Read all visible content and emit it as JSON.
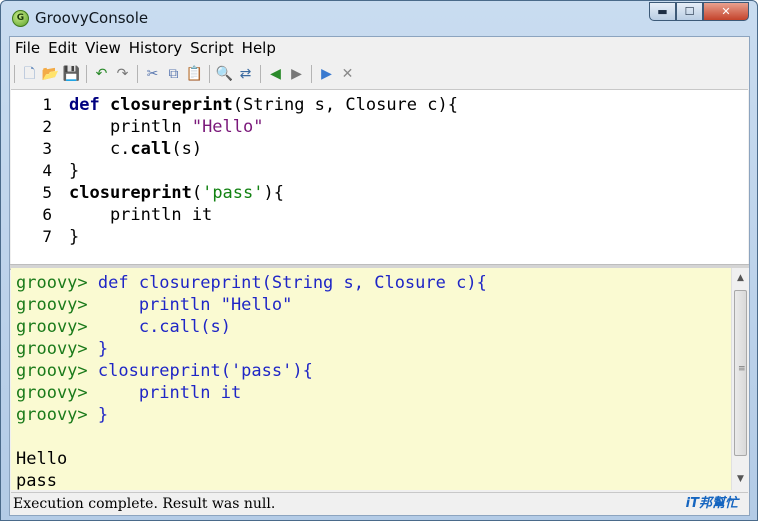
{
  "window": {
    "title": "GroovyConsole",
    "icon_letter": "G",
    "controls": {
      "minimize_icon": "▬",
      "maximize_icon": "☐",
      "close_icon": "✕"
    }
  },
  "menu": [
    "File",
    "Edit",
    "View",
    "History",
    "Script",
    "Help"
  ],
  "toolbar_icons": [
    {
      "name": "new-file-icon",
      "glyph": "🗋",
      "color": "#6a8fbf"
    },
    {
      "name": "open-folder-icon",
      "glyph": "📂",
      "color": "#e0a020"
    },
    {
      "name": "save-icon",
      "glyph": "💾",
      "color": "#3d6bb0"
    },
    {
      "name": "undo-icon",
      "glyph": "↶",
      "color": "#2a8a2a"
    },
    {
      "name": "redo-icon",
      "glyph": "↷",
      "color": "#777777"
    },
    {
      "name": "cut-icon",
      "glyph": "✂",
      "color": "#5a78b0"
    },
    {
      "name": "copy-icon",
      "glyph": "⧉",
      "color": "#5a78b0"
    },
    {
      "name": "paste-icon",
      "glyph": "📋",
      "color": "#b08040"
    },
    {
      "name": "find-icon",
      "glyph": "🔍",
      "color": "#333333"
    },
    {
      "name": "replace-icon",
      "glyph": "⇄",
      "color": "#3a6aa0"
    },
    {
      "name": "history-previous-icon",
      "glyph": "◀",
      "color": "#2a8a2a"
    },
    {
      "name": "history-next-icon",
      "glyph": "▶",
      "color": "#777777"
    },
    {
      "name": "run-script-icon",
      "glyph": "▶",
      "color": "#3a7ad0"
    },
    {
      "name": "interrupt-icon",
      "glyph": "✕",
      "color": "#8a8a8a"
    }
  ],
  "editor": {
    "lines": [
      {
        "n": "1",
        "parts": [
          [
            "kw",
            "def"
          ],
          [
            "t",
            " "
          ],
          [
            "fn",
            "closureprint"
          ],
          [
            "t",
            "(String s, Closure c){"
          ]
        ]
      },
      {
        "n": "2",
        "parts": [
          [
            "t",
            "    println "
          ],
          [
            "sd",
            "\"Hello\""
          ]
        ]
      },
      {
        "n": "3",
        "parts": [
          [
            "t",
            "    c."
          ],
          [
            "fn",
            "call"
          ],
          [
            "t",
            "(s)"
          ]
        ]
      },
      {
        "n": "4",
        "parts": [
          [
            "t",
            "}"
          ]
        ]
      },
      {
        "n": "5",
        "parts": [
          [
            "fn",
            "closureprint"
          ],
          [
            "t",
            "("
          ],
          [
            "ss",
            "'pass'"
          ],
          [
            "t",
            "){"
          ]
        ]
      },
      {
        "n": "6",
        "parts": [
          [
            "t",
            "    println it"
          ]
        ]
      },
      {
        "n": "7",
        "parts": [
          [
            "t",
            "}"
          ]
        ]
      }
    ]
  },
  "output": {
    "prompt": "groovy>",
    "echo_lines": [
      " def closureprint(String s, Closure c){",
      "     println \"Hello\"",
      "     c.call(s)",
      " }",
      " closureprint('pass'){",
      "     println it",
      " }"
    ],
    "result_lines": [
      "Hello",
      "pass"
    ]
  },
  "status": {
    "message": "Execution complete. Result was null.",
    "logo": "iT邦幫忙"
  },
  "colors": {
    "output_bg": "#fafad2",
    "prompt": "#1a7a1a",
    "echo": "#1f26c6",
    "keyword": "#000080",
    "double_string": "#7a187a",
    "single_string": "#128212"
  }
}
